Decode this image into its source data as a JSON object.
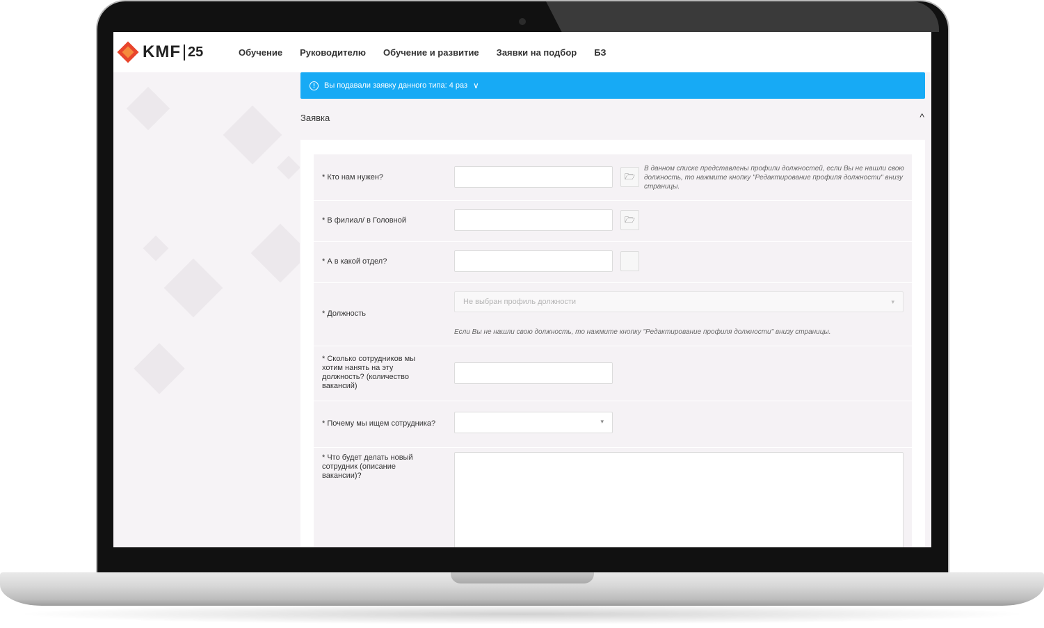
{
  "brand": {
    "logo_text": "KMF",
    "logo_num": "25"
  },
  "nav": {
    "items": [
      {
        "label": "Обучение"
      },
      {
        "label": "Руководителю"
      },
      {
        "label": "Обучение и развитие"
      },
      {
        "label": "Заявки на подбор"
      },
      {
        "label": "БЗ"
      }
    ]
  },
  "alert": {
    "icon": "!",
    "text": "Вы подавали заявку данного типа: 4 раз",
    "chevron": "∨"
  },
  "section": {
    "title": "Заявка",
    "toggle": "^"
  },
  "form": {
    "who_needed": {
      "label": "* Кто нам нужен?",
      "hint": "В данном списке представлены профили должностей, если Вы не нашли свою должность, то нажмите кнопку \"Редактирование профиля должности\" внизу страницы."
    },
    "branch": {
      "label": "* В филиал/ в Головной"
    },
    "department": {
      "label": "* А в какой отдел?"
    },
    "position": {
      "label": "* Должность",
      "placeholder": "Не выбран профиль должности",
      "hint": "Если Вы не нашли свою должность, то нажмите кнопку \"Редактирование профиля должности\" внизу страницы."
    },
    "count": {
      "label": "* Сколько сотрудников мы хотим нанять на эту должность? (количество вакансий)"
    },
    "reason": {
      "label": "* Почему мы ищем сотрудника?"
    },
    "description": {
      "label": "* Что будет делать новый сотрудник (описание вакансии)?"
    }
  },
  "icons": {
    "folder": "🗁",
    "caret": "▾"
  },
  "colors": {
    "alert_bg": "#17aaf5",
    "logo_red": "#e8452c",
    "logo_orange": "#f58a3c"
  }
}
